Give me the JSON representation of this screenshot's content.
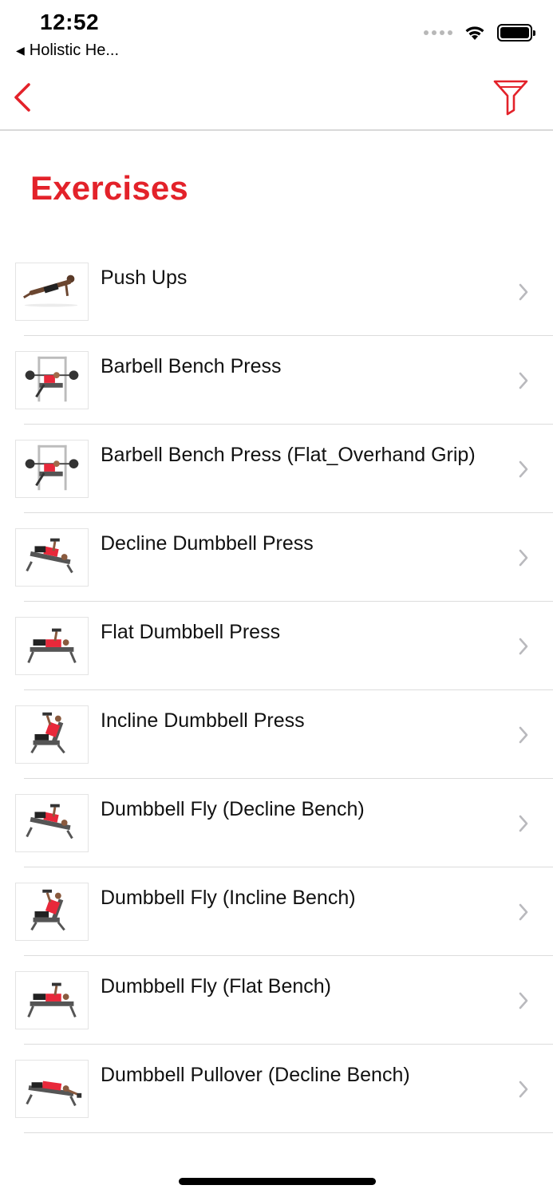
{
  "status_bar": {
    "time": "12:52",
    "back_app_label": "Holistic He...",
    "icons": [
      "cellular-dots-icon",
      "wifi-icon",
      "battery-icon"
    ]
  },
  "nav_bar": {
    "back_icon": "chevron-left-icon",
    "filter_icon": "filter-icon",
    "accent_color": "#e3222a"
  },
  "title": "Exercises",
  "exercises": [
    {
      "label": "Push Ups",
      "pose": "pushup"
    },
    {
      "label": "Barbell Bench Press",
      "pose": "rack"
    },
    {
      "label": "Barbell Bench Press (Flat_Overhand Grip)",
      "pose": "rack"
    },
    {
      "label": "Decline Dumbbell Press",
      "pose": "decline"
    },
    {
      "label": "Flat Dumbbell Press",
      "pose": "flat"
    },
    {
      "label": "Incline Dumbbell Press",
      "pose": "incline"
    },
    {
      "label": "Dumbbell Fly (Decline Bench)",
      "pose": "decline"
    },
    {
      "label": "Dumbbell Fly (Incline Bench)",
      "pose": "incline"
    },
    {
      "label": "Dumbbell Fly (Flat Bench)",
      "pose": "flat"
    },
    {
      "label": "Dumbbell Pullover (Decline Bench)",
      "pose": "pullover"
    }
  ],
  "colors": {
    "accent": "#e3222a",
    "shirt": "#e8283a",
    "chevron": "#b9b9bd",
    "divider": "#dcdcdc"
  }
}
